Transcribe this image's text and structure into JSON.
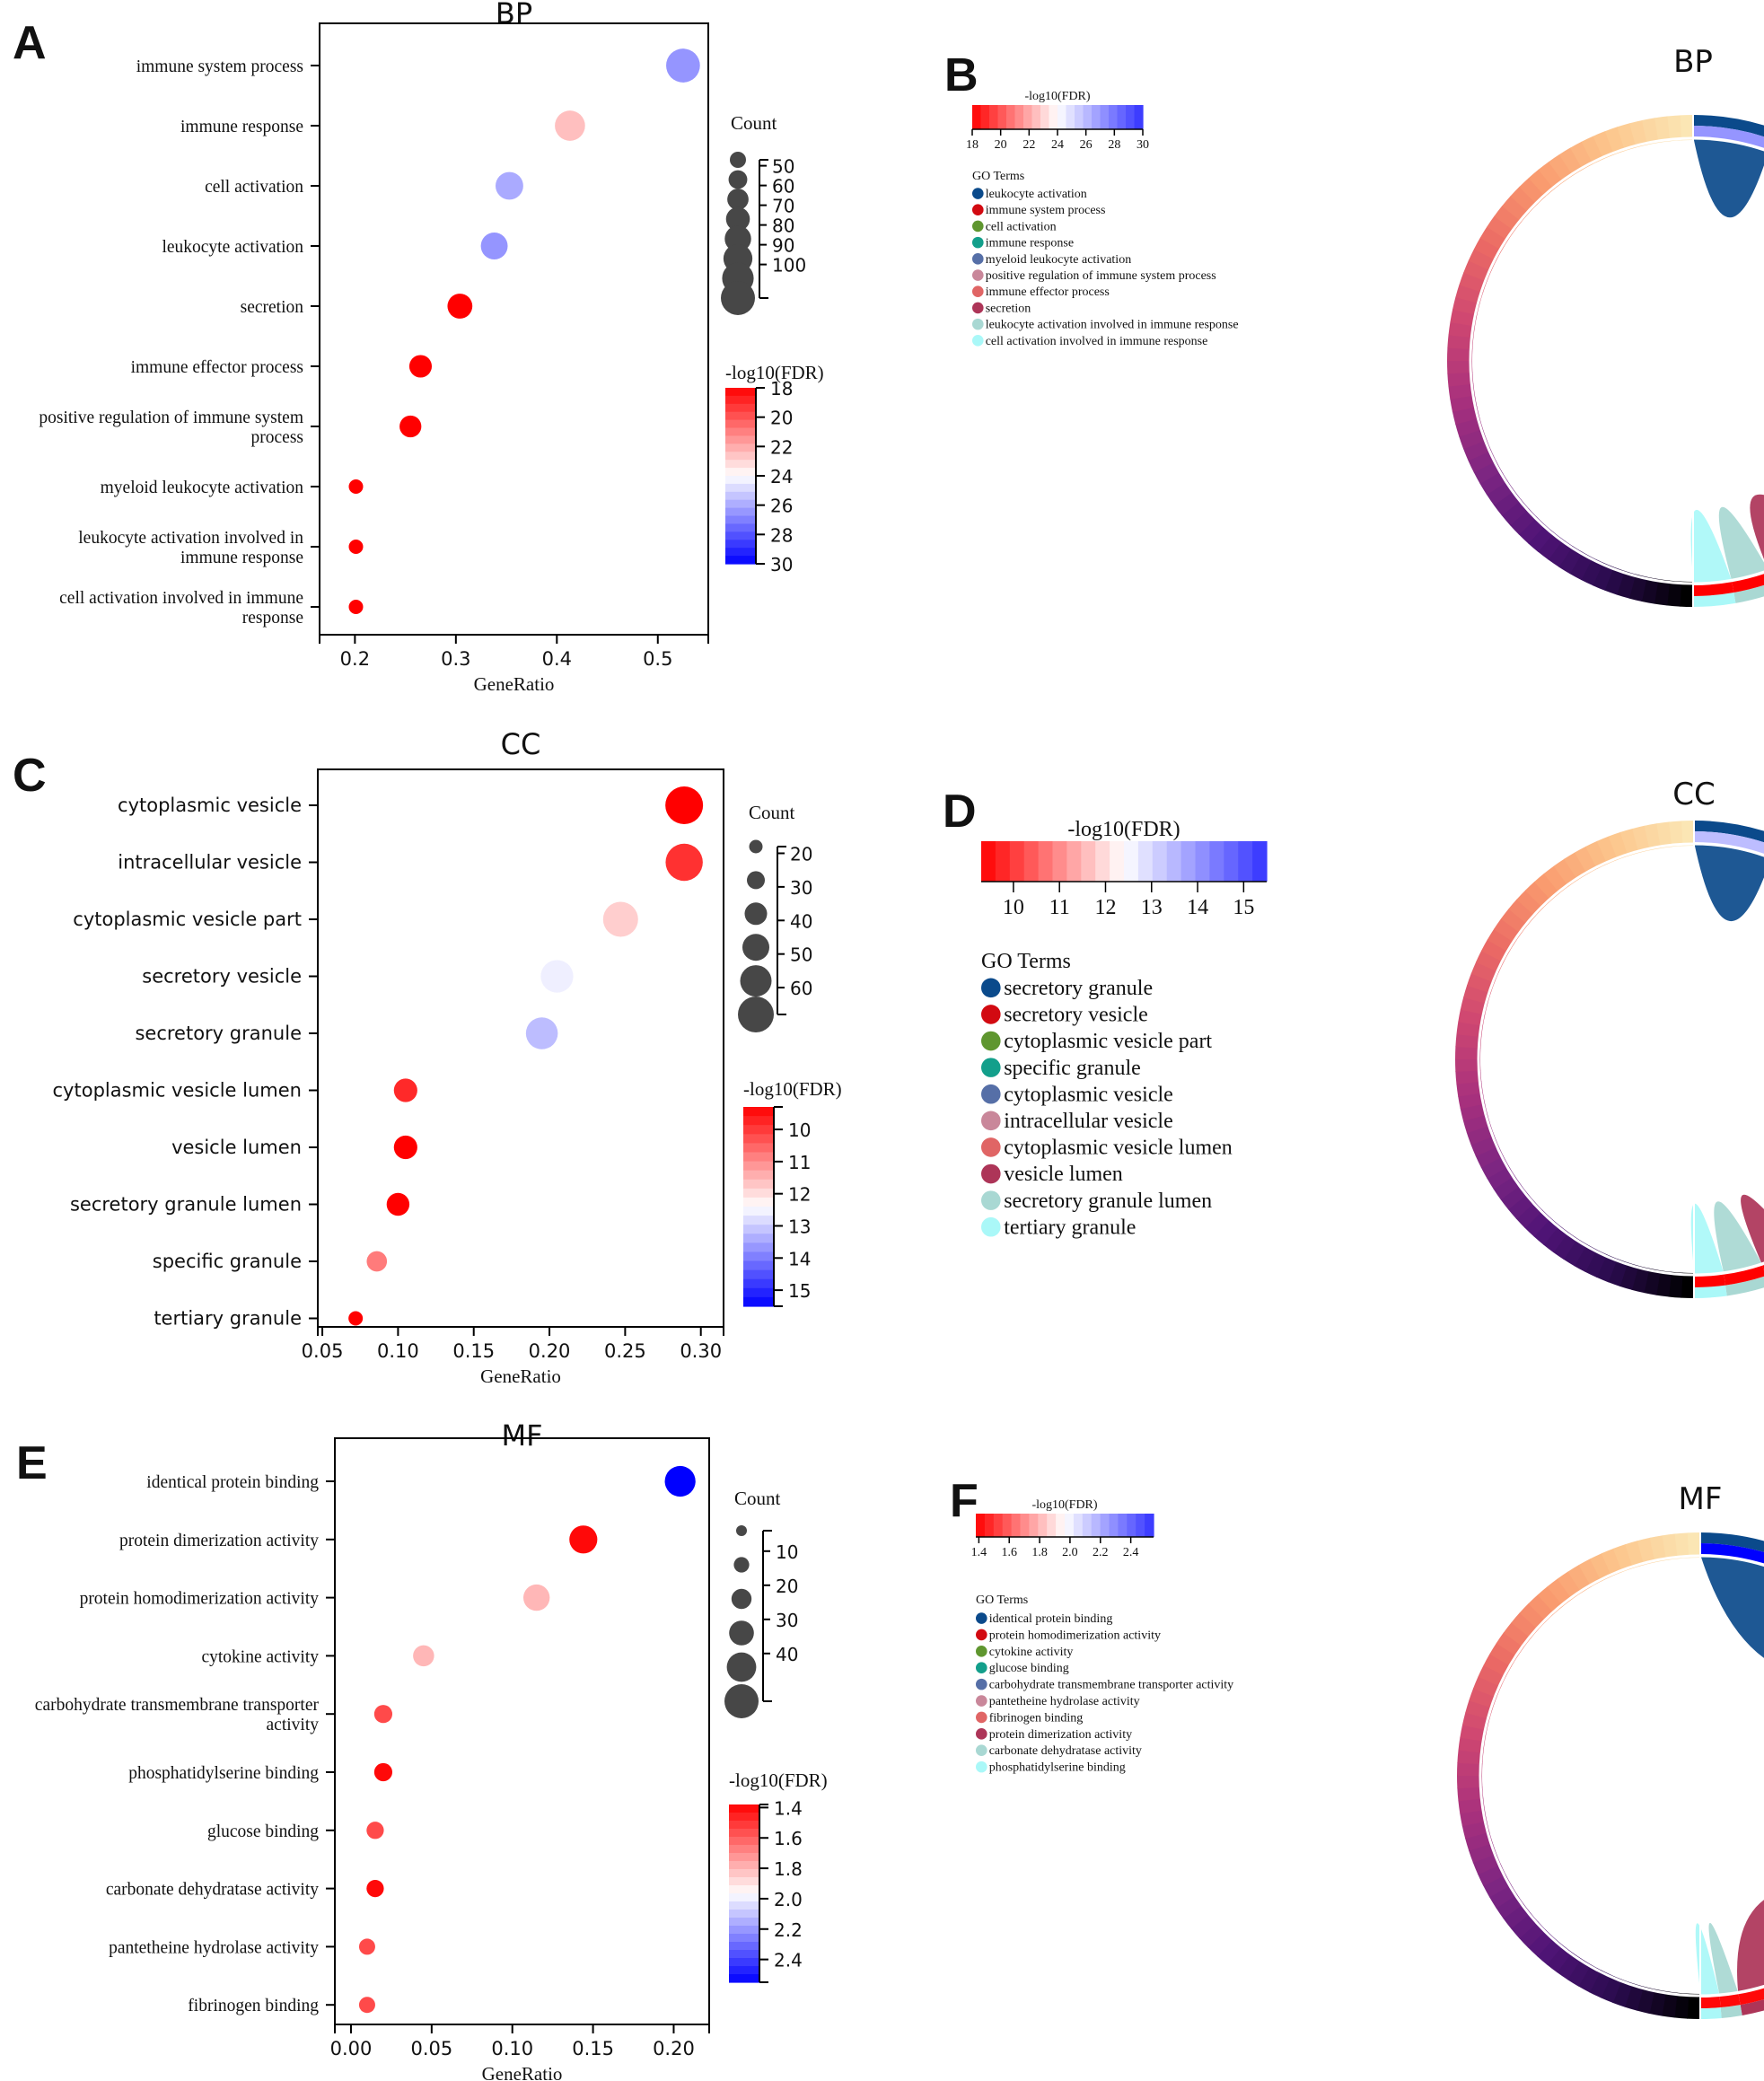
{
  "panel_letters": [
    "A",
    "B",
    "C",
    "D",
    "E",
    "F"
  ],
  "chart_data": [
    {
      "id": "A",
      "type": "scatter",
      "subtype": "bubble",
      "title": "BP",
      "xlabel": "GeneRatio",
      "ylabel": "",
      "xlim": [
        0.165,
        0.55
      ],
      "xticks": [
        0.2,
        0.3,
        0.4,
        0.5
      ],
      "xtick_labels": [
        "0.2",
        "0.3",
        "0.4",
        "0.5"
      ],
      "categories": [
        "immune system process",
        "immune response",
        "cell activation",
        "leukocyte activation",
        "secretion",
        "immune effector process",
        "positive regulation of immune system process",
        "myeloid leukocyte activation",
        "leukocyte activation involved in immune response",
        "cell activation involved in immune response"
      ],
      "category_lines": [
        [
          "immune system process"
        ],
        [
          "immune response"
        ],
        [
          "cell activation"
        ],
        [
          "leukocyte activation"
        ],
        [
          "secretion"
        ],
        [
          "immune effector process"
        ],
        [
          "positive regulation of immune system",
          "process"
        ],
        [
          "myeloid leukocyte activation"
        ],
        [
          "leukocyte activation involved in",
          "immune response"
        ],
        [
          "cell activation involved in immune",
          "response"
        ]
      ],
      "x": [
        0.525,
        0.413,
        0.353,
        0.338,
        0.304,
        0.265,
        0.255,
        0.201,
        0.201,
        0.201
      ],
      "count": [
        108,
        85,
        72,
        68,
        60,
        52,
        50,
        40,
        40,
        40
      ],
      "color_value": [
        26.5,
        22.5,
        26.0,
        26.5,
        18.0,
        18.0,
        18.0,
        18.0,
        18.0,
        18.0
      ],
      "size_legend": {
        "title": "Count",
        "values": [
          40,
          50,
          60,
          70,
          80,
          90,
          100,
          110
        ],
        "tick_labels": [
          "50",
          "60",
          "70",
          "80",
          "90",
          "100"
        ]
      },
      "color_legend": {
        "title": "-log10(FDR)",
        "range": [
          18,
          30
        ],
        "ticks": [
          18,
          20,
          22,
          24,
          26,
          28,
          30
        ],
        "tick_labels": [
          "18",
          "20",
          "22",
          "24",
          "26",
          "28",
          "30"
        ],
        "low_color": "#ff0000",
        "mid_color": "#ffffff",
        "high_color": "#0000ff"
      }
    },
    {
      "id": "C",
      "type": "scatter",
      "subtype": "bubble",
      "title": "CC",
      "xlabel": "GeneRatio",
      "ylabel": "",
      "xlim": [
        0.047,
        0.315
      ],
      "xticks": [
        0.05,
        0.1,
        0.15,
        0.2,
        0.25,
        0.3
      ],
      "xtick_labels": [
        "0.05",
        "0.10",
        "0.15",
        "0.20",
        "0.25",
        "0.30"
      ],
      "categories": [
        "cytoplasmic vesicle",
        "intracellular vesicle",
        "cytoplasmic vesicle part",
        "secretory vesicle",
        "secretory granule",
        "cytoplasmic vesicle lumen",
        "vesicle lumen",
        "secretory granule lumen",
        "specific granule",
        "tertiary granule"
      ],
      "category_lines": [
        [
          "cytoplasmic vesicle"
        ],
        [
          "intracellular vesicle"
        ],
        [
          "cytoplasmic vesicle part"
        ],
        [
          "secretory vesicle"
        ],
        [
          "secretory granule"
        ],
        [
          "cytoplasmic vesicle lumen"
        ],
        [
          "vesicle lumen"
        ],
        [
          "secretory granule lumen"
        ],
        [
          "specific granule"
        ],
        [
          "tertiary granule"
        ]
      ],
      "x": [
        0.289,
        0.289,
        0.247,
        0.205,
        0.195,
        0.105,
        0.105,
        0.1,
        0.086,
        0.072
      ],
      "count": [
        60,
        58,
        50,
        42,
        40,
        21,
        21,
        20,
        17,
        14
      ],
      "color_value": [
        9.3,
        9.9,
        11.8,
        12.6,
        13.2,
        9.8,
        9.3,
        9.3,
        10.8,
        9.3
      ],
      "size_legend": {
        "title": "Count",
        "values": [
          14,
          20,
          30,
          40,
          50,
          60
        ],
        "tick_labels": [
          "20",
          "30",
          "40",
          "50",
          "60"
        ]
      },
      "color_legend": {
        "title": "-log10(FDR)",
        "range": [
          9.3,
          15.5
        ],
        "ticks": [
          10,
          11,
          12,
          13,
          14,
          15
        ],
        "tick_labels": [
          "10",
          "11",
          "12",
          "13",
          "14",
          "15"
        ],
        "low_color": "#ff0000",
        "mid_color": "#ffffff",
        "high_color": "#0000ff"
      }
    },
    {
      "id": "E",
      "type": "scatter",
      "subtype": "bubble",
      "title": "MF",
      "xlabel": "GeneRatio",
      "ylabel": "",
      "xlim": [
        -0.01,
        0.222
      ],
      "xticks": [
        0.0,
        0.05,
        0.1,
        0.15,
        0.2
      ],
      "xtick_labels": [
        "0.00",
        "0.05",
        "0.10",
        "0.15",
        "0.20"
      ],
      "categories": [
        "identical protein binding",
        "protein dimerization activity",
        "protein homodimerization activity",
        "cytokine activity",
        "carbohydrate transmembrane transporter activity",
        "phosphatidylserine binding",
        "glucose binding",
        "carbonate dehydratase activity",
        "pantetheine hydrolase activity",
        "fibrinogen binding"
      ],
      "category_lines": [
        [
          "identical protein binding"
        ],
        [
          "protein dimerization activity"
        ],
        [
          "protein homodimerization activity"
        ],
        [
          "cytokine activity"
        ],
        [
          "carbohydrate transmembrane transporter",
          "activity"
        ],
        [
          "phosphatidylserine binding"
        ],
        [
          "glucose binding"
        ],
        [
          "carbonate dehydratase activity"
        ],
        [
          "pantetheine hydrolase activity"
        ],
        [
          "fibrinogen binding"
        ]
      ],
      "x": [
        0.204,
        0.144,
        0.115,
        0.045,
        0.02,
        0.02,
        0.015,
        0.015,
        0.01,
        0.01
      ],
      "count": [
        42,
        30,
        24,
        9,
        4,
        4,
        3,
        3,
        2,
        2
      ],
      "color_value": [
        2.55,
        1.4,
        1.8,
        1.8,
        1.55,
        1.4,
        1.55,
        1.4,
        1.55,
        1.55
      ],
      "size_legend": {
        "title": "Count",
        "values": [
          1,
          10,
          20,
          30,
          40,
          50
        ],
        "tick_labels": [
          "10",
          "20",
          "30",
          "40"
        ]
      },
      "color_legend": {
        "title": "-log10(FDR)",
        "range": [
          1.38,
          2.55
        ],
        "ticks": [
          1.4,
          1.6,
          1.8,
          2.0,
          2.2,
          2.4
        ],
        "tick_labels": [
          "1.4",
          "1.6",
          "1.8",
          "2.0",
          "2.2",
          "2.4"
        ],
        "low_color": "#ff0000",
        "mid_color": "#ffffff",
        "high_color": "#0000ff"
      }
    },
    {
      "id": "B",
      "type": "chord",
      "title": "BP",
      "color_legend": {
        "title": "-log10(FDR)",
        "range": [
          18,
          30
        ],
        "tick_labels": [
          "18",
          "20",
          "22",
          "24",
          "26",
          "28",
          "30"
        ]
      },
      "legend_title": "GO Terms",
      "terms": [
        {
          "name": "leukocyte activation",
          "color": "#0b4a8b",
          "weight": 8
        },
        {
          "name": "immune system process",
          "color": "#d20a11",
          "weight": 13
        },
        {
          "name": "cell activation",
          "color": "#5f962f",
          "weight": 9
        },
        {
          "name": "immune response",
          "color": "#139f8b",
          "weight": 11
        },
        {
          "name": "myeloid leukocyte activation",
          "color": "#566fa7",
          "weight": 5
        },
        {
          "name": "positive regulation of immune system process",
          "color": "#c9879a",
          "weight": 6
        },
        {
          "name": "immune effector process",
          "color": "#e06565",
          "weight": 6
        },
        {
          "name": "secretion",
          "color": "#ad3558",
          "weight": 7
        },
        {
          "name": "leukocyte activation involved in immune response",
          "color": "#a9d8d3",
          "weight": 4
        },
        {
          "name": "cell activation involved in immune response",
          "color": "#aaf8f8",
          "weight": 4
        }
      ],
      "fdr_ring": [
        26.5,
        26.5,
        26.0,
        22.5,
        18.0,
        18.0,
        18.0,
        18.0,
        18.0,
        18.0
      ]
    },
    {
      "id": "D",
      "type": "chord",
      "title": "CC",
      "color_legend": {
        "title": "-log10(FDR)",
        "range": [
          9.3,
          15.5
        ],
        "tick_labels": [
          "10",
          "11",
          "12",
          "13",
          "14",
          "15"
        ]
      },
      "legend_title": "GO Terms",
      "terms": [
        {
          "name": "secretory granule",
          "color": "#0b4a8b",
          "weight": 8
        },
        {
          "name": "secretory vesicle",
          "color": "#d20a11",
          "weight": 8
        },
        {
          "name": "cytoplasmic vesicle part",
          "color": "#5f962f",
          "weight": 10
        },
        {
          "name": "specific granule",
          "color": "#139f8b",
          "weight": 3
        },
        {
          "name": "cytoplasmic vesicle",
          "color": "#566fa7",
          "weight": 13
        },
        {
          "name": "intracellular vesicle",
          "color": "#c9879a",
          "weight": 12
        },
        {
          "name": "cytoplasmic vesicle lumen",
          "color": "#e06565",
          "weight": 4
        },
        {
          "name": "vesicle lumen",
          "color": "#ad3558",
          "weight": 4
        },
        {
          "name": "secretory granule lumen",
          "color": "#a9d8d3",
          "weight": 4
        },
        {
          "name": "tertiary granule",
          "color": "#aaf8f8",
          "weight": 3
        }
      ],
      "fdr_ring": [
        13.2,
        12.6,
        11.8,
        10.8,
        9.3,
        9.9,
        9.8,
        9.3,
        9.3,
        9.3
      ]
    },
    {
      "id": "F",
      "type": "chord",
      "title": "MF",
      "color_legend": {
        "title": "-log10(FDR)",
        "range": [
          1.38,
          2.55
        ],
        "tick_labels": [
          "1.4",
          "1.6",
          "1.8",
          "2.0",
          "2.2",
          "2.4"
        ]
      },
      "legend_title": "GO Terms",
      "terms": [
        {
          "name": "identical protein binding",
          "color": "#0b4a8b",
          "weight": 18
        },
        {
          "name": "protein homodimerization activity",
          "color": "#d20a11",
          "weight": 11
        },
        {
          "name": "cytokine activity",
          "color": "#5f962f",
          "weight": 4
        },
        {
          "name": "glucose binding",
          "color": "#139f8b",
          "weight": 1.5
        },
        {
          "name": "carbohydrate transmembrane transporter activity",
          "color": "#566fa7",
          "weight": 1.5
        },
        {
          "name": "pantetheine hydrolase activity",
          "color": "#c9879a",
          "weight": 1
        },
        {
          "name": "fibrinogen binding",
          "color": "#e06565",
          "weight": 1
        },
        {
          "name": "protein dimerization activity",
          "color": "#ad3558",
          "weight": 14
        },
        {
          "name": "carbonate dehydratase activity",
          "color": "#a9d8d3",
          "weight": 1.5
        },
        {
          "name": "phosphatidylserine binding",
          "color": "#aaf8f8",
          "weight": 1.5
        }
      ],
      "fdr_ring": [
        2.55,
        1.8,
        1.8,
        1.55,
        1.55,
        1.55,
        1.55,
        1.4,
        1.4,
        1.4
      ]
    }
  ]
}
